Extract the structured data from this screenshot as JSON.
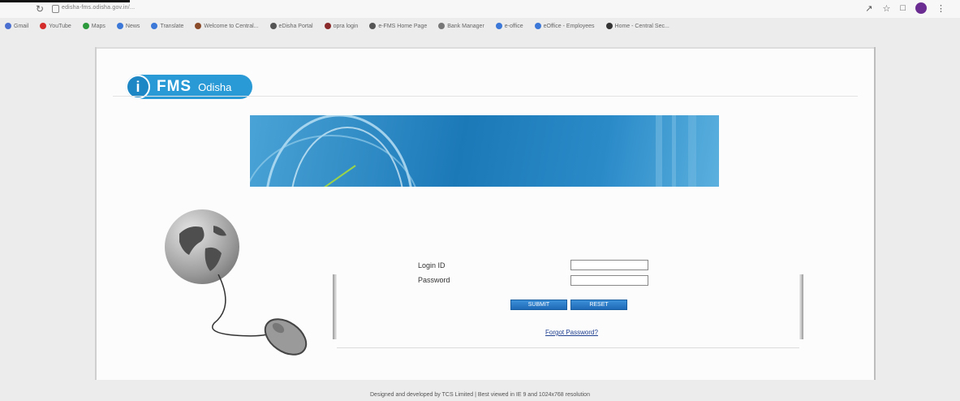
{
  "browser": {
    "url": "edisha-fms.odisha.gov.in/...",
    "reload_icon": "reload-icon"
  },
  "bookmarks": [
    {
      "label": "Gmail",
      "color": "#4a6fd1"
    },
    {
      "label": "YouTube",
      "color": "#d42b2b"
    },
    {
      "label": "Maps",
      "color": "#2c9a3c"
    },
    {
      "label": "News",
      "color": "#3b78d8"
    },
    {
      "label": "Translate",
      "color": "#3b78d8"
    },
    {
      "label": "Welcome to Central...",
      "color": "#8a4b2a"
    },
    {
      "label": "eDisha Portal",
      "color": "#555555"
    },
    {
      "label": "opra login",
      "color": "#8a2a2a"
    },
    {
      "label": "e-FMS Home Page",
      "color": "#555555"
    },
    {
      "label": "Bank Manager",
      "color": "#777777"
    },
    {
      "label": "e-office",
      "color": "#3b78d8"
    },
    {
      "label": "eOffice - Employees",
      "color": "#3b78d8"
    },
    {
      "label": "Home - Central Sec...",
      "color": "#333333"
    }
  ],
  "logo": {
    "letter": "i",
    "title": "FMS",
    "subtitle": "Odisha"
  },
  "login": {
    "login_id_label": "Login ID",
    "password_label": "Password",
    "login_id_value": "",
    "password_value": "",
    "submit_label": "SUBMIT",
    "reset_label": "RESET",
    "forgot_label": "Forgot Password?"
  },
  "footer": {
    "text": "Designed and developed by TCS Limited | Best viewed in IE 9 and 1024x768 resolution"
  },
  "colors": {
    "accent": "#2a9ad6",
    "button": "#1f6ab8",
    "avatar": "#6a2c91"
  }
}
